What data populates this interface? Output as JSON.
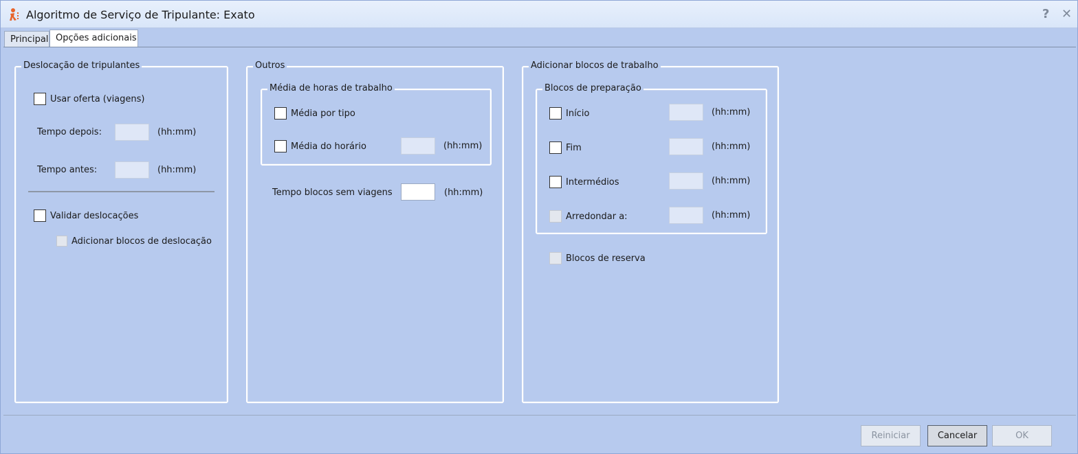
{
  "window": {
    "title": "Algoritmo de Serviço de Tripulante: Exato",
    "help_glyph": "?",
    "close_glyph": "✕"
  },
  "tabs": [
    {
      "label": "Principal",
      "active": false
    },
    {
      "label": "Opções adicionais",
      "active": true
    }
  ],
  "crew_displacement": {
    "title": "Deslocação de tripulantes",
    "use_offer": {
      "label": "Usar oferta (viagens)",
      "checked": false
    },
    "time_after": {
      "label": "Tempo depois:",
      "value": "",
      "unit": "(hh:mm)"
    },
    "time_before": {
      "label": "Tempo antes:",
      "value": "",
      "unit": "(hh:mm)"
    },
    "validate": {
      "label": "Validar deslocações",
      "checked": false
    },
    "add_blocks": {
      "label": "Adicionar blocos de deslocação",
      "checked": false,
      "disabled": true
    }
  },
  "others": {
    "title": "Outros",
    "avg_hours": {
      "title": "Média de horas de trabalho",
      "per_type": {
        "label": "Média por tipo",
        "checked": false
      },
      "schedule": {
        "label": "Média do horário",
        "checked": false,
        "value": "",
        "unit": "(hh:mm)"
      }
    },
    "blocks_no_trips": {
      "label": "Tempo blocos sem viagens",
      "value": "",
      "unit": "(hh:mm)"
    }
  },
  "work_blocks": {
    "title": "Adicionar blocos de trabalho",
    "prep": {
      "title": "Blocos de preparação",
      "start": {
        "label": "Início",
        "checked": false,
        "value": "",
        "unit": "(hh:mm)"
      },
      "end": {
        "label": "Fim",
        "checked": false,
        "value": "",
        "unit": "(hh:mm)"
      },
      "middle": {
        "label": "Intermédios",
        "checked": false,
        "value": "",
        "unit": "(hh:mm)"
      },
      "round": {
        "label": "Arredondar a:",
        "checked": false,
        "disabled": true,
        "value": "",
        "unit": "(hh:mm)"
      }
    },
    "reserve": {
      "label": "Blocos de reserva",
      "checked": false,
      "disabled": true
    }
  },
  "footer": {
    "reset": "Reiniciar",
    "cancel": "Cancelar",
    "ok": "OK"
  }
}
